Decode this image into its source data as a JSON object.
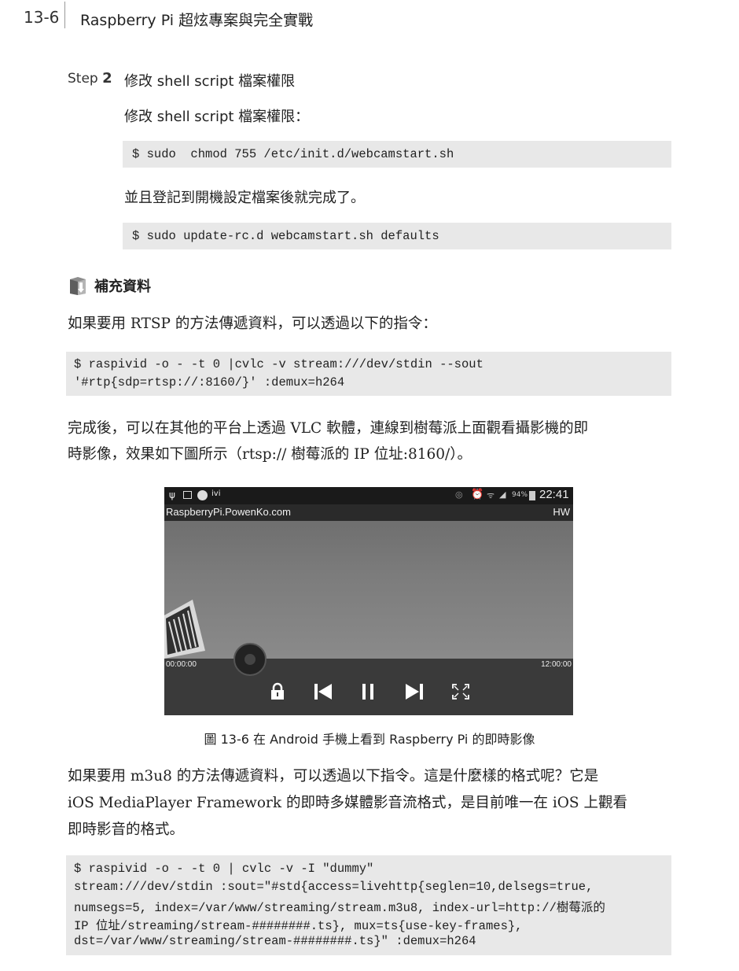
{
  "header": {
    "page_number": "13-6",
    "book_title": "Raspberry Pi 超炫專案與完全實戰"
  },
  "step": {
    "label_prefix": "Step",
    "label_number": "2",
    "title": "修改 shell script 檔案權限",
    "intro": "修改 shell script 檔案權限：",
    "code1": "$ sudo  chmod 755 /etc/init.d/webcamstart.sh",
    "after": "並且登記到開機設定檔案後就完成了。",
    "code2": "$ sudo update-rc.d webcamstart.sh defaults"
  },
  "note": {
    "icon": "book-icon",
    "title": "補充資料"
  },
  "rtsp": {
    "intro": "如果要用 RTSP 的方法傳遞資料，可以透過以下的指令：",
    "code_line1": "$ raspivid -o - -t 0 |cvlc -v stream:///dev/stdin --sout",
    "code_line2": "'#rtp{sdp=rtsp://:8160/}' :demux=h264",
    "after_line1": "完成後，可以在其他的平台上透過 VLC 軟體，連線到樹莓派上面觀看攝影機的即",
    "after_line2": "時影像，效果如下圖所示（rtsp:// 樹莓派的 IP 位址:8160/）。"
  },
  "screenshot": {
    "status_right": "94%",
    "time": "22:41",
    "app_title": "RaspberryPi.PowenKo.com",
    "hw_label": "HW",
    "elapsed": "00:00:00",
    "duration": "12:00:00",
    "controls": [
      "lock-icon",
      "skip-previous-icon",
      "pause-icon",
      "skip-next-icon",
      "fullscreen-icon"
    ]
  },
  "figure": {
    "caption": "圖 13-6  在 Android 手機上看到 Raspberry Pi 的即時影像"
  },
  "m3u8": {
    "line1": "如果要用 m3u8 的方法傳遞資料，可以透過以下指令。這是什麼樣的格式呢？它是",
    "line2": "iOS MediaPlayer Framework 的即時多媒體影音流格式，是目前唯一在 iOS 上觀看",
    "line3": "即時影音的格式。",
    "code_line1": "$ raspivid -o - -t 0 | cvlc -v -I \"dummy\"",
    "code_line2": "stream:///dev/stdin :sout=\"#std{access=livehttp{seglen=10,delsegs=true,",
    "code_line3": "numsegs=5, index=/var/www/streaming/stream.m3u8, index-url=http://樹莓派的",
    "code_line4": "IP 位址/streaming/stream-########.ts}, mux=ts{use-key-frames},",
    "code_line5": "dst=/var/www/streaming/stream-########.ts}\" :demux=h264"
  }
}
